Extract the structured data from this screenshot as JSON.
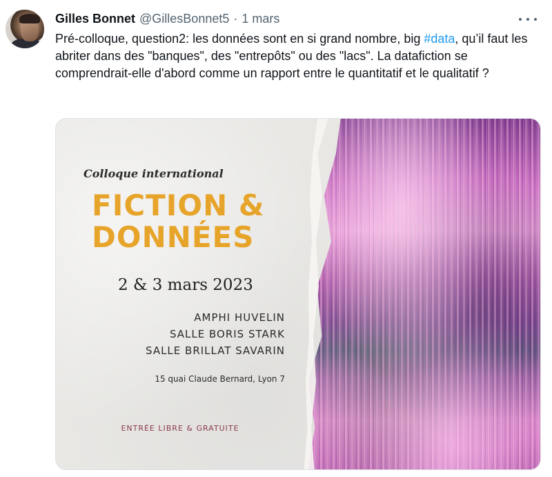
{
  "tweet": {
    "author_name": "Gilles Bonnet",
    "handle": "@GillesBonnet5",
    "separator": "·",
    "time": "1 mars",
    "text_before": "Pré-colloque, question2: les données sont en si grand nombre, big ",
    "hashtag": "#data",
    "text_after": ", qu’il faut les abriter dans des \"banques\", des \"entrepôts\" ou des \"lacs\". La datafiction se comprendrait-elle d'abord comme un rapport entre le quantitatif et le qualitatif ?"
  },
  "icons": {
    "avatar": "profile-photo",
    "more": "more-horizontal-icon"
  },
  "poster": {
    "subtitle": "Colloque international",
    "title_line1": "FICTION &",
    "title_line2": "DONNÉES",
    "dates": "2 & 3 mars 2023",
    "venues": [
      "AMPHI HUVELIN",
      "SALLE BORIS STARK",
      "SALLE BRILLAT SAVARIN"
    ],
    "address": "15 quai Claude Bernard, Lyon 7",
    "entry": "ENTRÉE LIBRE & GRATUITE"
  },
  "colors": {
    "hashtag": "#1d9bf0",
    "poster_title": "#e7a42a",
    "poster_entry": "#8a3b4b"
  }
}
